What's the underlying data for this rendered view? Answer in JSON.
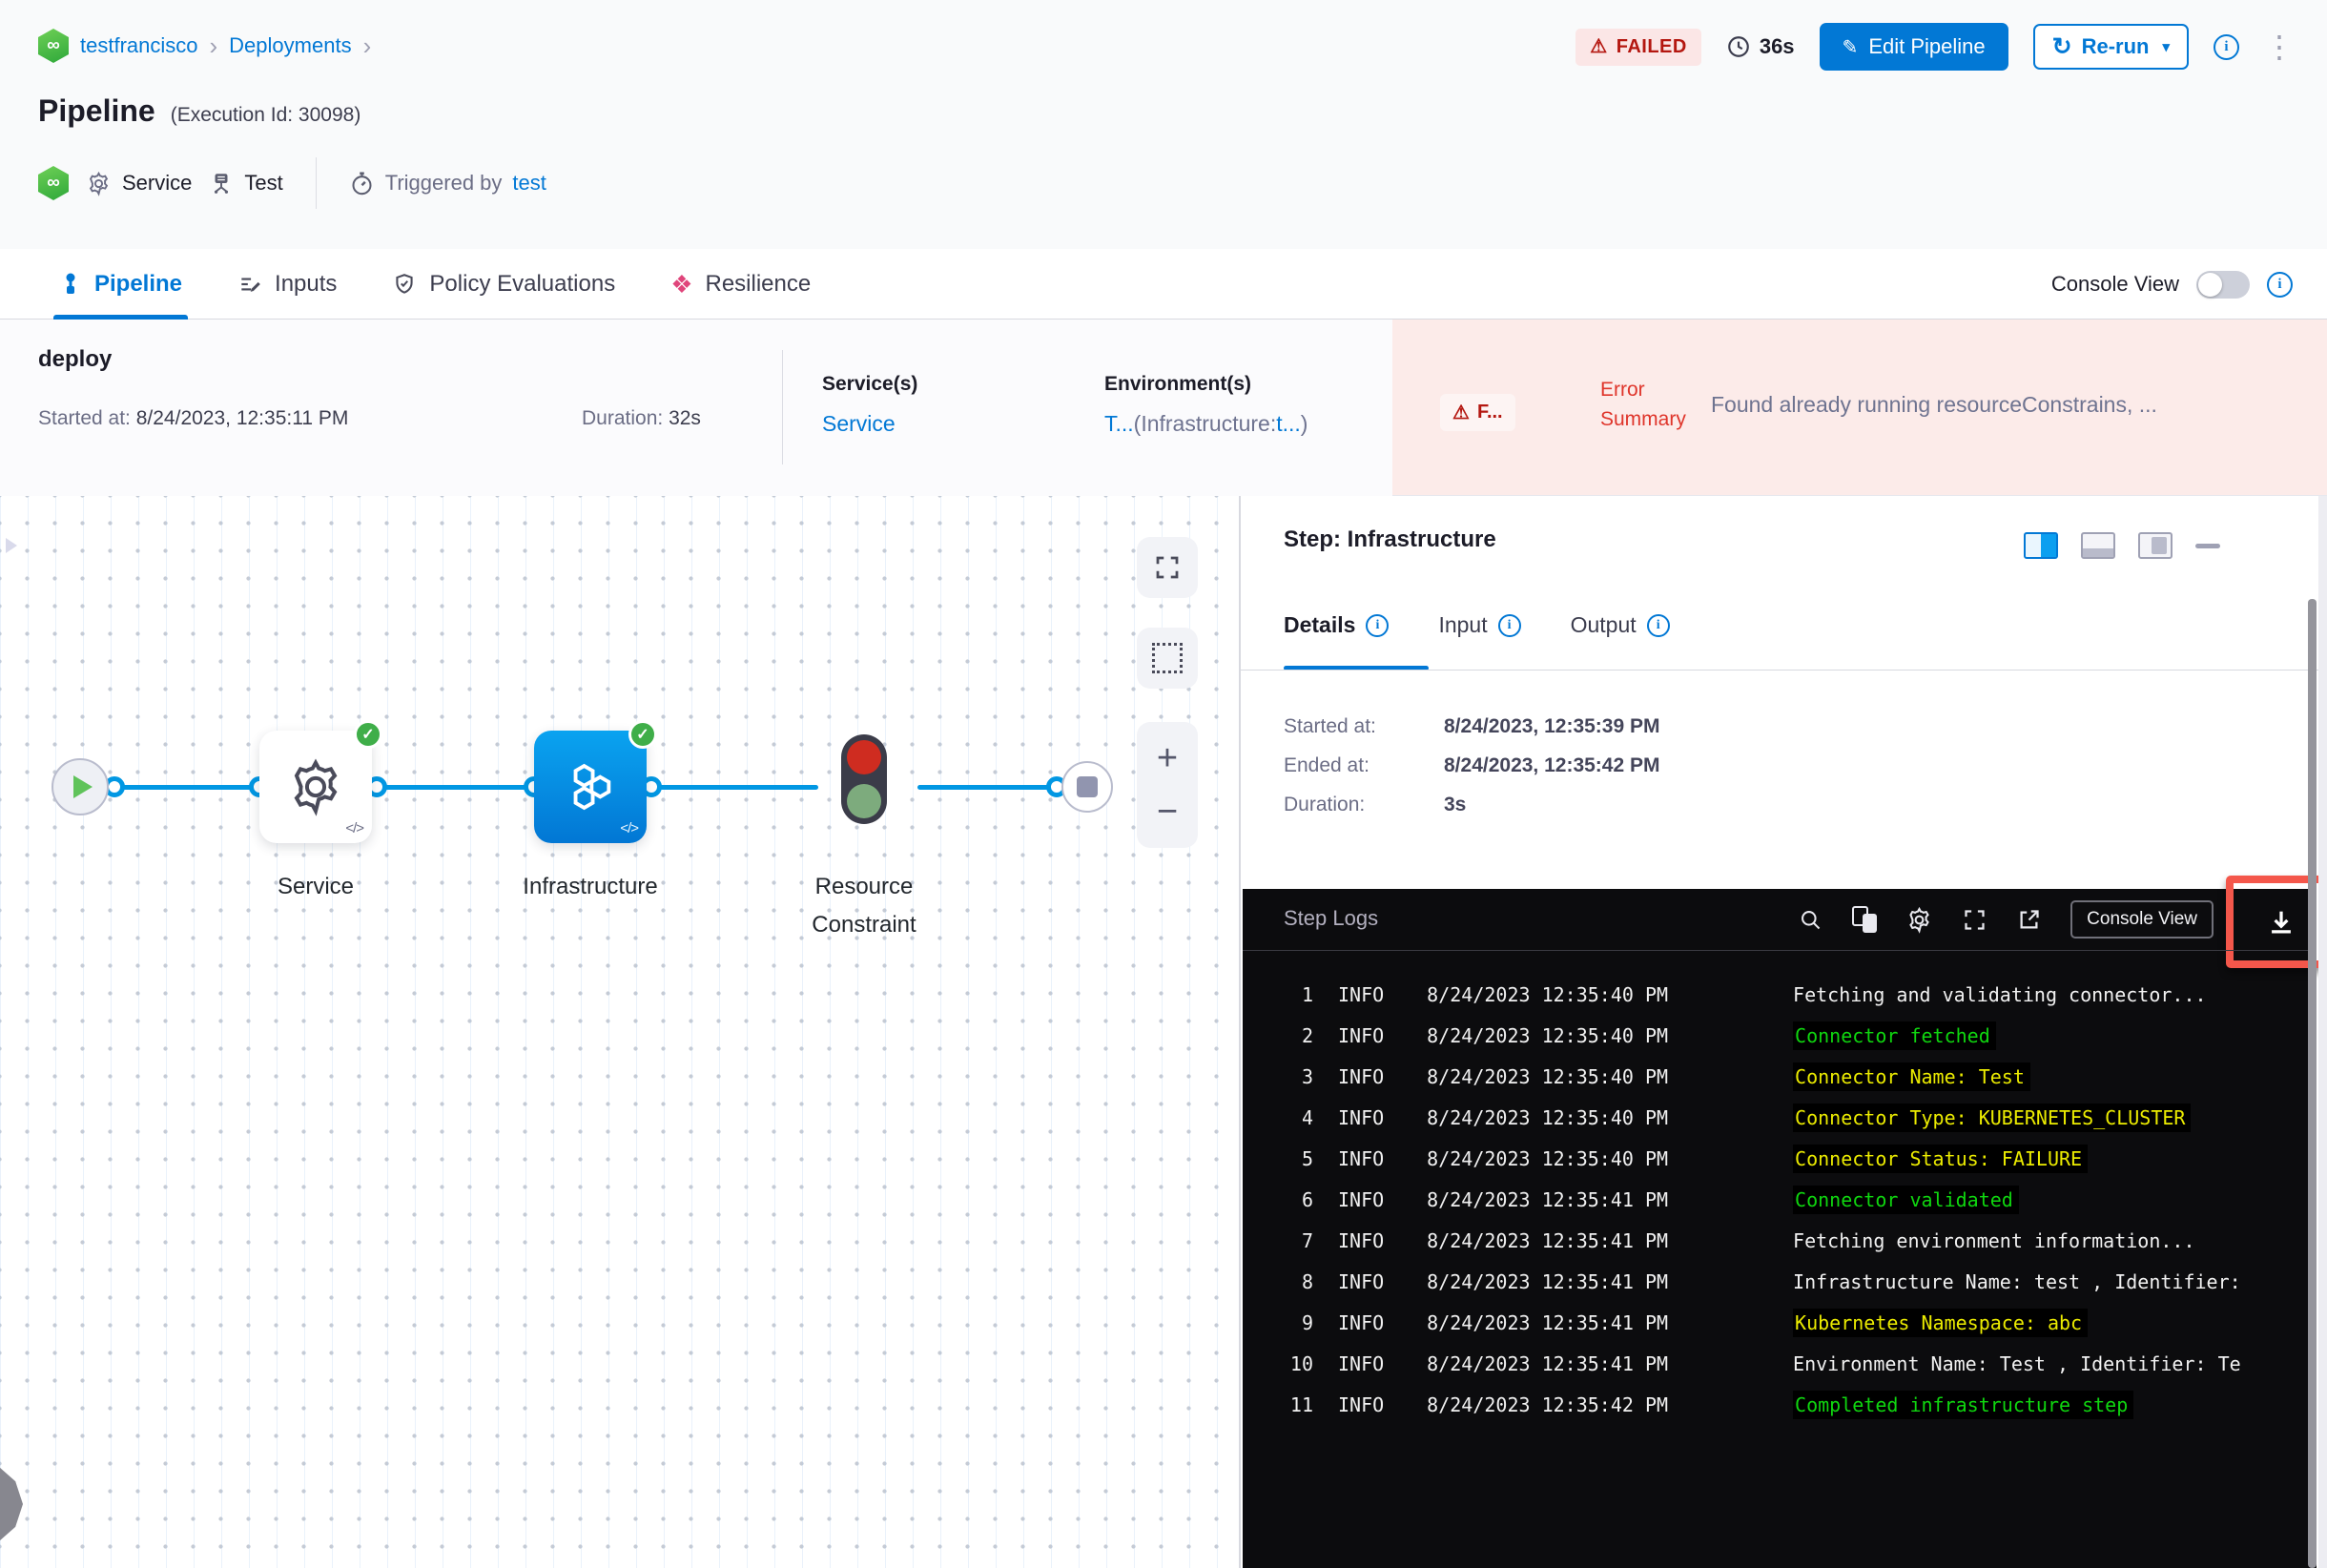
{
  "breadcrumb": {
    "project": "testfrancisco",
    "section": "Deployments"
  },
  "header": {
    "title": "Pipeline",
    "execution_id": "(Execution Id: 30098)",
    "service_label": "Service",
    "test_label": "Test",
    "triggered_by_label": "Triggered by",
    "trigger_user": "test",
    "failed_badge": "FAILED",
    "elapsed": "36s",
    "edit_pipeline": "Edit Pipeline",
    "rerun": "Re-run"
  },
  "tabs": {
    "pipeline": "Pipeline",
    "inputs": "Inputs",
    "policy": "Policy Evaluations",
    "resilience": "Resilience",
    "console_view": "Console View"
  },
  "stage": {
    "name": "deploy",
    "started_label": "Started at:",
    "started_value": "8/24/2023, 12:35:11 PM",
    "duration_label": "Duration:",
    "duration_value": "32s",
    "services_header": "Service(s)",
    "service_link": "Service",
    "env_header": "Environment(s)",
    "env_t": "T...",
    "env_infra": "(Infrastructure:",
    "env_t2": "t...",
    "env_close": ")"
  },
  "error": {
    "badge": "F...",
    "label_line1": "Error",
    "label_line2": "Summary",
    "message": "Found already running resourceConstrains, ..."
  },
  "graph": {
    "service_label": "Service",
    "infra_label": "Infrastructure",
    "rc_label_line1": "Resource",
    "rc_label_line2": "Constraint",
    "code_glyph": "</>",
    "zoom_in": "+",
    "zoom_out": "−"
  },
  "step_panel": {
    "title": "Step: Infrastructure",
    "tab_details": "Details",
    "tab_input": "Input",
    "tab_output": "Output",
    "started_label": "Started at:",
    "started_value": "8/24/2023, 12:35:39 PM",
    "ended_label": "Ended at:",
    "ended_value": "8/24/2023, 12:35:42 PM",
    "duration_label": "Duration:",
    "duration_value": "3s"
  },
  "step_logs": {
    "title": "Step Logs",
    "console_view_button": "Console View",
    "lines": [
      {
        "num": "1",
        "level": "INFO",
        "time": "8/24/2023 12:35:40 PM",
        "msg": "Fetching and validating connector...",
        "color": "white"
      },
      {
        "num": "2",
        "level": "INFO",
        "time": "8/24/2023 12:35:40 PM",
        "msg": "Connector fetched",
        "color": "green"
      },
      {
        "num": "3",
        "level": "INFO",
        "time": "8/24/2023 12:35:40 PM",
        "msg": "Connector Name: Test",
        "color": "yellow"
      },
      {
        "num": "4",
        "level": "INFO",
        "time": "8/24/2023 12:35:40 PM",
        "msg": "Connector Type: KUBERNETES_CLUSTER",
        "color": "yellow"
      },
      {
        "num": "5",
        "level": "INFO",
        "time": "8/24/2023 12:35:40 PM",
        "msg": "Connector Status: FAILURE",
        "color": "yellow"
      },
      {
        "num": "6",
        "level": "INFO",
        "time": "8/24/2023 12:35:41 PM",
        "msg": "Connector validated",
        "color": "green"
      },
      {
        "num": "7",
        "level": "INFO",
        "time": "8/24/2023 12:35:41 PM",
        "msg": "Fetching environment information...",
        "color": "white"
      },
      {
        "num": "8",
        "level": "INFO",
        "time": "8/24/2023 12:35:41 PM",
        "msg": "Infrastructure Name: test , Identifier:",
        "color": "white"
      },
      {
        "num": "9",
        "level": "INFO",
        "time": "8/24/2023 12:35:41 PM",
        "msg": "Kubernetes Namespace: abc",
        "color": "yellow"
      },
      {
        "num": "10",
        "level": "INFO",
        "time": "8/24/2023 12:35:41 PM",
        "msg": "Environment Name: Test , Identifier: Te",
        "color": "white"
      },
      {
        "num": "11",
        "level": "INFO",
        "time": "8/24/2023 12:35:42 PM",
        "msg": "Completed infrastructure step",
        "color": "green"
      }
    ]
  },
  "colors": {
    "accent_blue": "#0278d5",
    "connector_blue": "#0197e3",
    "failed_red": "#b41710",
    "error_bg": "#fcebe9",
    "success_green": "#3fae49",
    "log_green": "#0fd60f",
    "log_yellow": "#ebeb00",
    "highlight_red": "#f4574b"
  },
  "glyphs": {
    "logo": "∞",
    "warning": "⚠",
    "pencil": "✎",
    "refresh": "↻",
    "caret": "▾",
    "chevron": "›",
    "kebab": "⋮",
    "check": "✓",
    "info": "i",
    "resilience": "❖"
  }
}
